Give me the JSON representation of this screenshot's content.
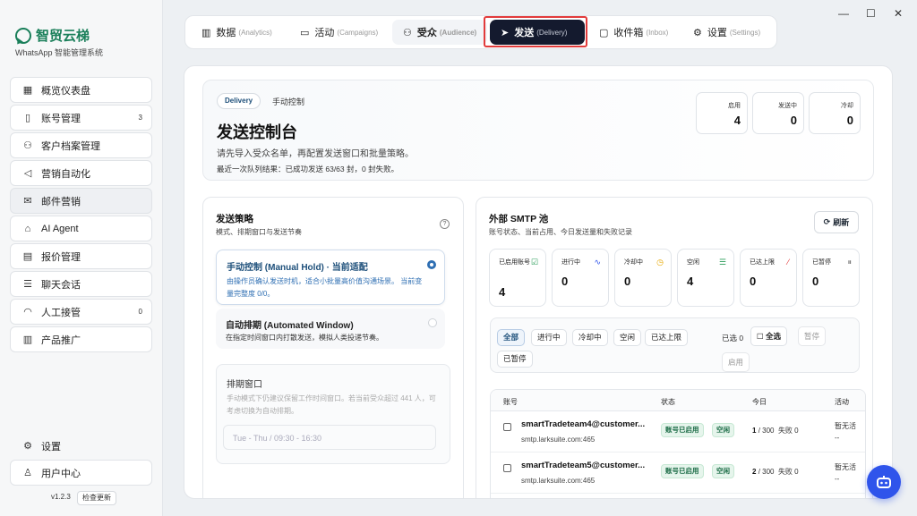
{
  "app": {
    "name": "智贸云梯",
    "subtitle": "WhatsApp 智能管理系统",
    "version": "v1.2.3",
    "check_update": "检查更新"
  },
  "window": {
    "minimize_icon": "minimize-icon",
    "maximize_icon": "maximize-icon",
    "close_icon": "close-icon"
  },
  "sidebar": {
    "items": [
      {
        "label": "概览仪表盘",
        "icon": "dashboard-icon",
        "badge": ""
      },
      {
        "label": "账号管理",
        "icon": "phone-icon",
        "badge": "3"
      },
      {
        "label": "客户档案管理",
        "icon": "users-icon",
        "badge": ""
      },
      {
        "label": "营销自动化",
        "icon": "megaphone-icon",
        "badge": ""
      },
      {
        "label": "邮件营销",
        "icon": "mail-icon",
        "badge": ""
      },
      {
        "label": "AI Agent",
        "icon": "bot-icon",
        "badge": ""
      },
      {
        "label": "报价管理",
        "icon": "document-icon",
        "badge": ""
      },
      {
        "label": "聊天会话",
        "icon": "list-icon",
        "badge": ""
      },
      {
        "label": "人工接管",
        "icon": "headset-icon",
        "badge": "0"
      },
      {
        "label": "产品推广",
        "icon": "map-icon",
        "badge": ""
      }
    ],
    "settings": "设置",
    "user_center": "用户中心"
  },
  "tabs": [
    {
      "label": "数据",
      "en": "(Analytics)",
      "icon": "chart-icon"
    },
    {
      "label": "活动",
      "en": "(Campaigns)",
      "icon": "layout-icon"
    },
    {
      "label": "受众",
      "en": "(Audience)",
      "icon": "users-icon"
    },
    {
      "label": "发送",
      "en": "(Delivery)",
      "icon": "send-icon"
    },
    {
      "label": "收件箱",
      "en": "(Inbox)",
      "icon": "inbox-icon"
    },
    {
      "label": "设置",
      "en": "(Settings)",
      "icon": "gear-icon"
    }
  ],
  "hero": {
    "pill": "Delivery",
    "crumb": "手动控制",
    "title": "发送控制台",
    "desc": "请先导入受众名单，再配置发送窗口和批量策略。",
    "last_result": "最近一次队列结果：已成功发送 63/63 封，0 封失败。",
    "stats": [
      {
        "label": "启用",
        "value": "4"
      },
      {
        "label": "发送中",
        "value": "0"
      },
      {
        "label": "冷却",
        "value": "0"
      }
    ]
  },
  "strategy": {
    "title": "发送策略",
    "subtitle": "模式、排期窗口与发送节奏",
    "options": [
      {
        "title": "手动控制 (Manual Hold) · 当前适配",
        "desc": "由操作员确认发送时机，适合小批量高价值沟通场景。 当前变量完整度 0/0。",
        "selected": true
      },
      {
        "title": "自动排期 (Automated Window)",
        "desc": "在指定时间窗口内打散发送，模拟人类投递节奏。",
        "selected": false
      }
    ],
    "window_title": "排期窗口",
    "window_desc": "手动模式下仍建议保留工作时间窗口。若当前受众超过 441 人，可考虑切换为自动排期。",
    "window_placeholder": "Tue - Thu / 09:30 - 16:30"
  },
  "smtp": {
    "title": "外部 SMTP 池",
    "subtitle": "账号状态、当前占用、今日发送量和失败记录",
    "refresh": "刷新",
    "stats": [
      {
        "label": "已启用账号",
        "value": "4",
        "icon": "check-square-icon",
        "color": "#2e9e5b"
      },
      {
        "label": "进行中",
        "value": "0",
        "icon": "activity-icon",
        "color": "#2f54eb"
      },
      {
        "label": "冷却中",
        "value": "0",
        "icon": "clock-icon",
        "color": "#e6a700"
      },
      {
        "label": "空闲",
        "value": "4",
        "icon": "server-icon",
        "color": "#2e9e5b"
      },
      {
        "label": "已达上限",
        "value": "0",
        "icon": "slash-icon",
        "color": "#e23b3b"
      },
      {
        "label": "已暂停",
        "value": "0",
        "icon": "pause-icon",
        "color": "#777777"
      }
    ],
    "filters": [
      "全部",
      "进行中",
      "冷却中",
      "空闲",
      "已达上限",
      "已暂停"
    ],
    "selected": "已选 0",
    "select_all": "全选",
    "pause": "暂停",
    "enable": "启用",
    "columns": [
      "账号",
      "状态",
      "今日",
      "活动"
    ],
    "rows": [
      {
        "name": "smartTradeteam4@customer...",
        "host": "smtp.larksuite.com:465",
        "status": "账号已启用",
        "state": "空闲",
        "sent": "1",
        "limit": "/ 300",
        "fail": "失败 0",
        "activity": "暂无活",
        "activity2": "--"
      },
      {
        "name": "smartTradeteam5@customer...",
        "host": "smtp.larksuite.com:465",
        "status": "账号已启用",
        "state": "空闲",
        "sent": "2",
        "limit": "/ 300",
        "fail": "失败 0",
        "activity": "暂无活",
        "activity2": "--"
      }
    ]
  },
  "assistant_icon": "robot-icon"
}
